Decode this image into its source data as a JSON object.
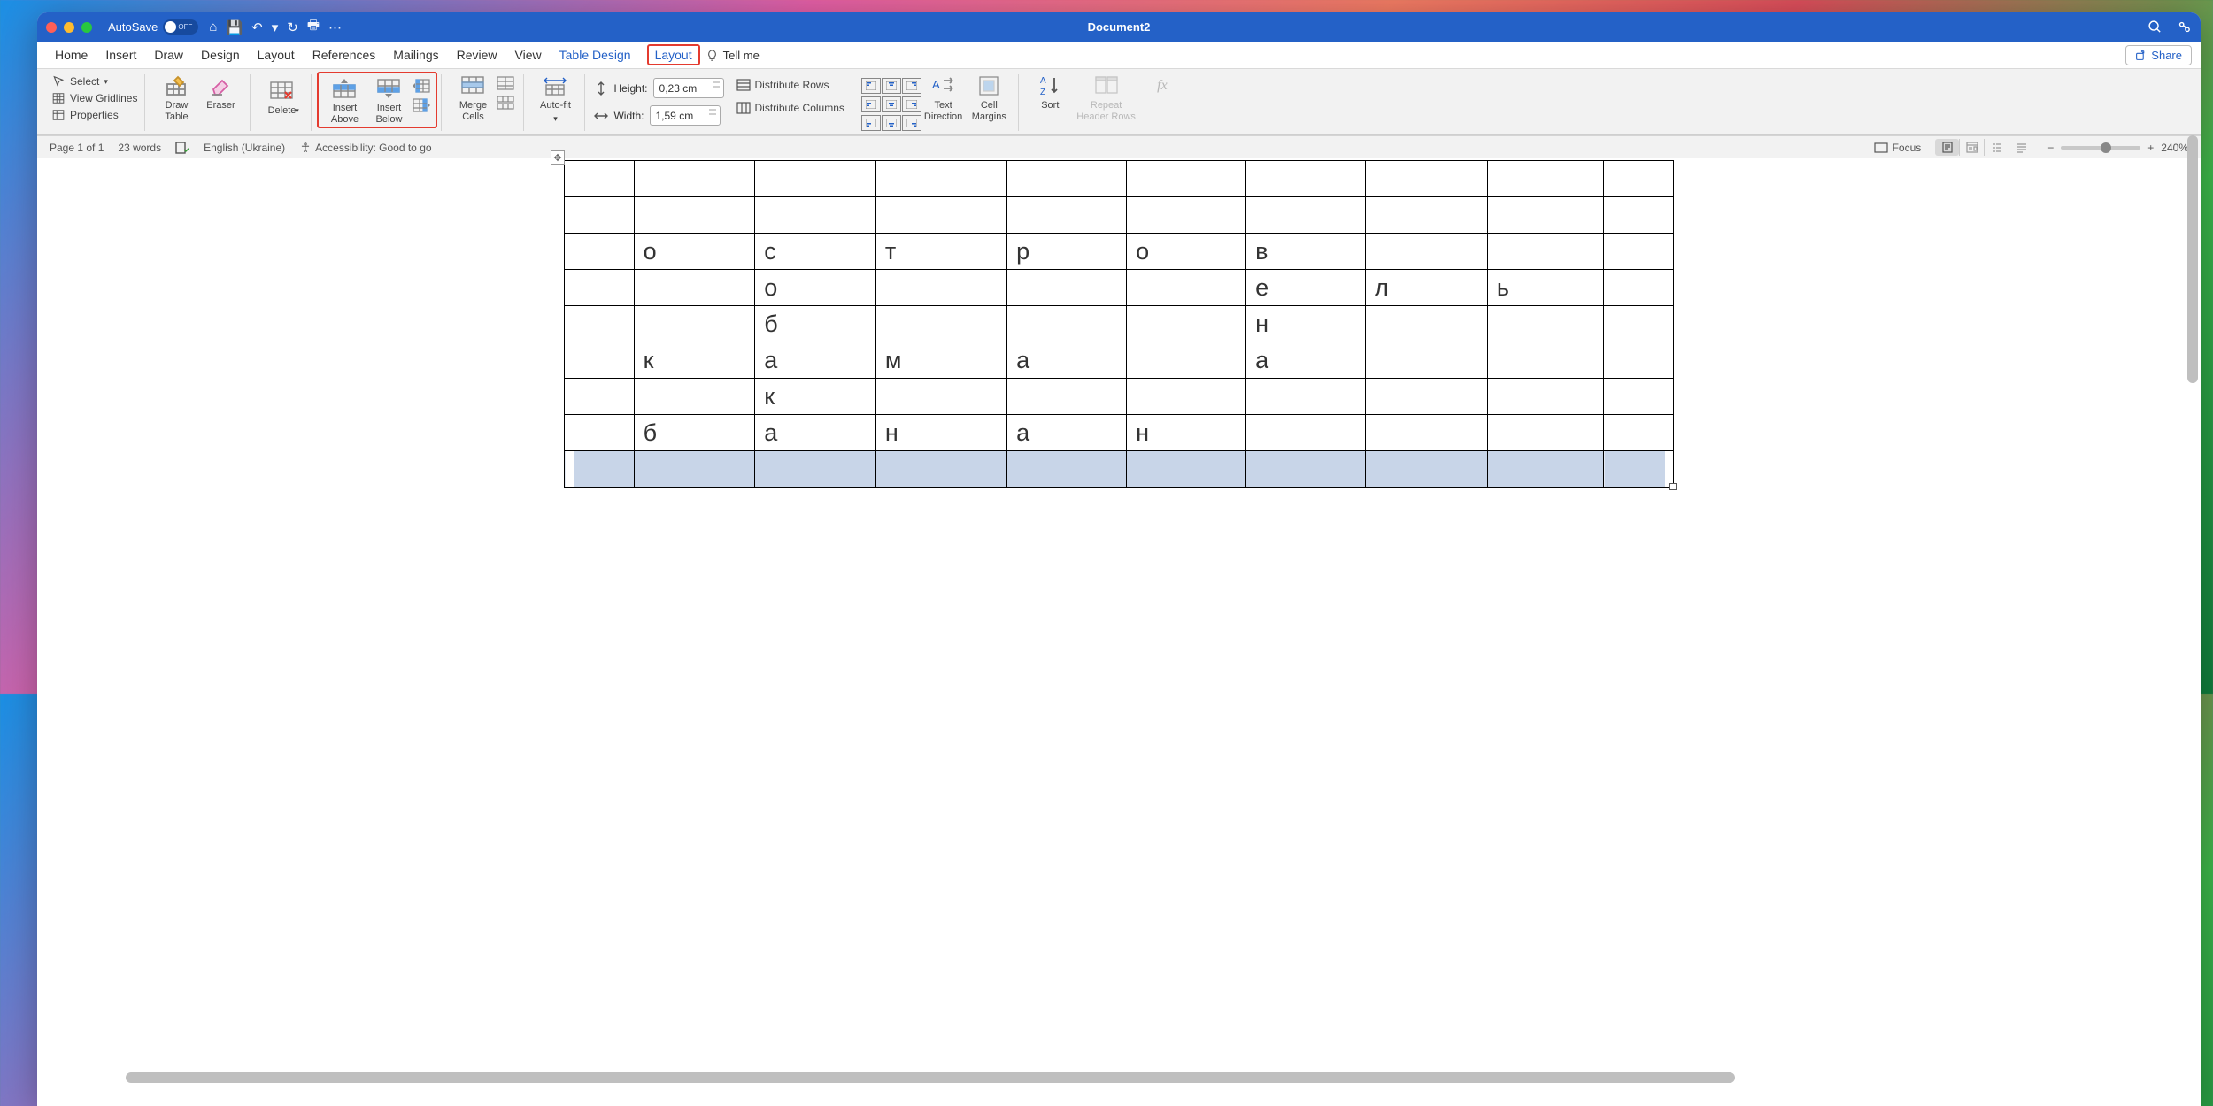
{
  "titlebar": {
    "autosave_label": "AutoSave",
    "autosave_state": "OFF",
    "title": "Document2"
  },
  "tabs": {
    "home": "Home",
    "insert": "Insert",
    "draw": "Draw",
    "design": "Design",
    "layout": "Layout",
    "references": "References",
    "mailings": "Mailings",
    "review": "Review",
    "view": "View",
    "table_design": "Table Design",
    "table_layout": "Layout",
    "tell_me": "Tell me",
    "share": "Share"
  },
  "ribbon": {
    "select": "Select",
    "view_gridlines": "View Gridlines",
    "properties": "Properties",
    "draw_table": "Draw\nTable",
    "eraser": "Eraser",
    "delete": "Delete",
    "insert_above": "Insert\nAbove",
    "insert_below": "Insert\nBelow",
    "merge_cells": "Merge\nCells",
    "autofit": "Auto-fit",
    "height_label": "Height:",
    "height_value": "0,23 cm",
    "width_label": "Width:",
    "width_value": "1,59 cm",
    "distribute_rows": "Distribute Rows",
    "distribute_columns": "Distribute Columns",
    "text_direction": "Text\nDirection",
    "cell_margins": "Cell\nMargins",
    "sort": "Sort",
    "repeat_header": "Repeat\nHeader Rows",
    "fx": "fx"
  },
  "table": {
    "rows": [
      [
        "",
        "",
        "",
        "",
        "",
        "",
        "",
        "",
        "",
        ""
      ],
      [
        "",
        "",
        "",
        "",
        "",
        "",
        "",
        "",
        "",
        ""
      ],
      [
        "",
        "о",
        "с",
        "т",
        "р",
        "о",
        "в",
        "",
        "",
        ""
      ],
      [
        "",
        "",
        "о",
        "",
        "",
        "",
        "е",
        "л",
        "ь",
        ""
      ],
      [
        "",
        "",
        "б",
        "",
        "",
        "",
        "н",
        "",
        "",
        ""
      ],
      [
        "",
        "к",
        "а",
        "м",
        "а",
        "",
        "а",
        "",
        "",
        ""
      ],
      [
        "",
        "",
        "к",
        "",
        "",
        "",
        "",
        "",
        "",
        ""
      ],
      [
        "",
        "б",
        "а",
        "н",
        "а",
        "н",
        "",
        "",
        "",
        ""
      ],
      [
        "",
        "",
        "",
        "",
        "",
        "",
        "",
        "",
        "",
        ""
      ]
    ],
    "selected_row_index": 8
  },
  "status": {
    "page": "Page 1 of 1",
    "words": "23 words",
    "language": "English (Ukraine)",
    "accessibility": "Accessibility: Good to go",
    "focus": "Focus",
    "zoom": "240%"
  }
}
